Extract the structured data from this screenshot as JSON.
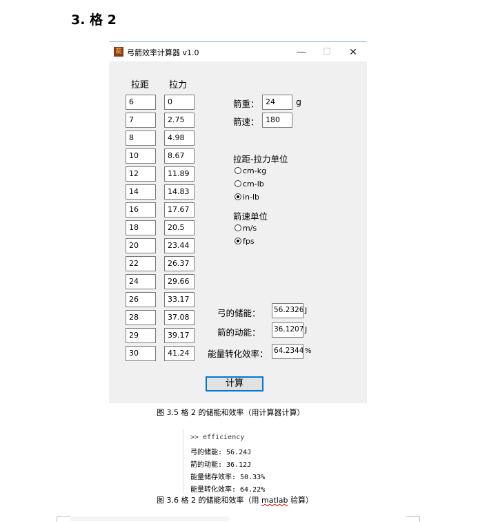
{
  "heading": "3.  格 2",
  "window": {
    "title": "弓箭效率计算器 v1.0",
    "icon_char": "箭",
    "min": "—",
    "max": "☐",
    "close": "✕"
  },
  "table": {
    "col1": "拉距",
    "col2": "拉力",
    "draw": [
      "6",
      "7",
      "8",
      "10",
      "12",
      "14",
      "16",
      "18",
      "20",
      "22",
      "24",
      "26",
      "28",
      "29",
      "30"
    ],
    "force": [
      "0",
      "2.75",
      "4.98",
      "8.67",
      "11.89",
      "14.83",
      "17.67",
      "20.5",
      "23.44",
      "26.37",
      "29.66",
      "33.17",
      "37.08",
      "39.17",
      "41.24"
    ]
  },
  "arrow": {
    "weight_label": "箭重：",
    "weight_value": "24",
    "weight_unit": "g",
    "speed_label": "箭速：",
    "speed_value": "180"
  },
  "units": {
    "draw_force_label": "拉距-拉力单位",
    "options": [
      "cm-kg",
      "cm-lb",
      "in-lb"
    ],
    "selected": "in-lb",
    "speed_label": "箭速单位",
    "speed_options": [
      "m/s",
      "fps"
    ],
    "speed_selected": "fps"
  },
  "results": {
    "bow_energy_label": "弓的储能：",
    "bow_energy_value": "56.2326",
    "bow_energy_unit": "J",
    "arrow_ke_label": "箭的动能：",
    "arrow_ke_value": "36.1207",
    "arrow_ke_unit": "J",
    "efficiency_label": "能量转化效率：",
    "efficiency_value": "64.2344",
    "efficiency_unit": "%"
  },
  "calc_button": "计算",
  "caption1": "图 3.5  格 2 的储能和效率（用计算器计算）",
  "console": {
    "lines": [
      ">> efficiency",
      "弓的储能: 56.24J",
      "箭的动能: 36.12J",
      "能量储存效率: 50.33%",
      "能量转化效率: 64.22%"
    ]
  },
  "caption2_prefix": "图 3.6  格 2 的储能和效率（用 ",
  "caption2_word": "matlab",
  "caption2_suffix": " 验算）"
}
